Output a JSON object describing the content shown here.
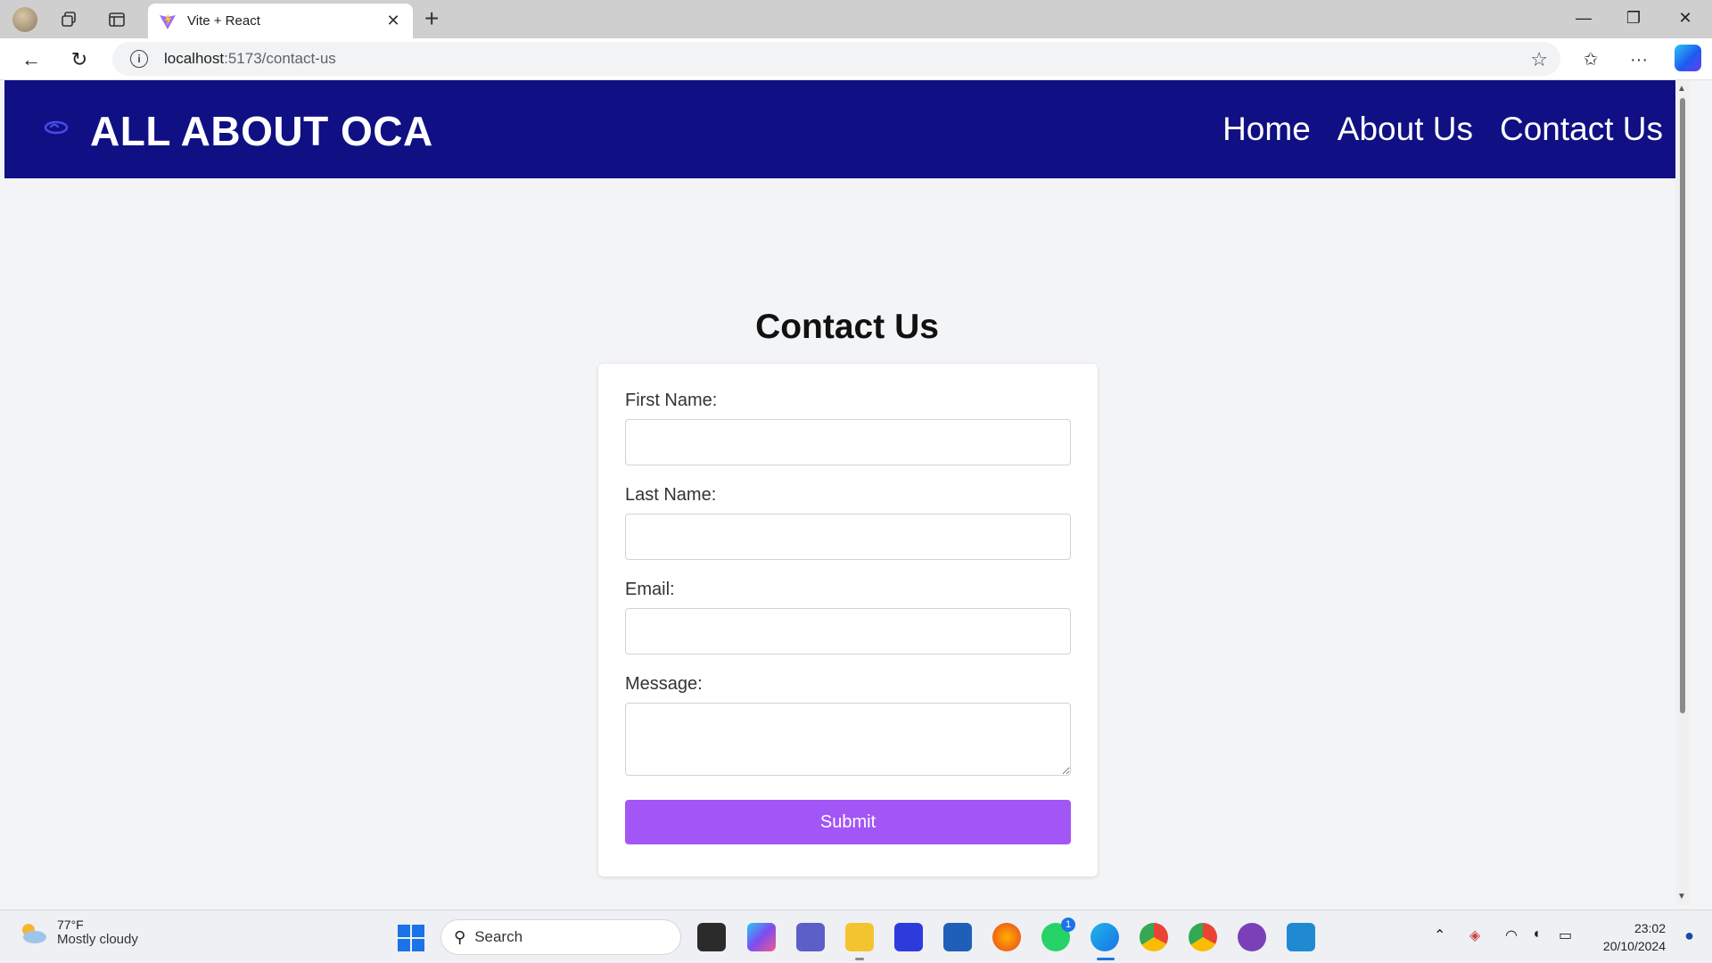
{
  "browser": {
    "tab_title": "Vite + React",
    "url_host": "localhost",
    "url_path": ":5173/contact-us",
    "new_tab_symbol": "+",
    "tab_close_symbol": "✕"
  },
  "site": {
    "brand": "ALL ABOUT OCA",
    "nav": [
      "Home",
      "About Us",
      "Contact Us"
    ],
    "accent_color": "#101084"
  },
  "contact": {
    "heading": "Contact Us",
    "first_name_label": "First Name:",
    "last_name_label": "Last Name:",
    "email_label": "Email:",
    "message_label": "Message:",
    "first_name_value": "",
    "last_name_value": "",
    "email_value": "",
    "message_value": "",
    "submit_label": "Submit",
    "submit_color": "#a356f6"
  },
  "taskbar": {
    "temperature": "77°F",
    "weather": "Mostly cloudy",
    "search_label": "Search",
    "time": "23:02",
    "date": "20/10/2024",
    "whatsapp_badge": "1"
  }
}
